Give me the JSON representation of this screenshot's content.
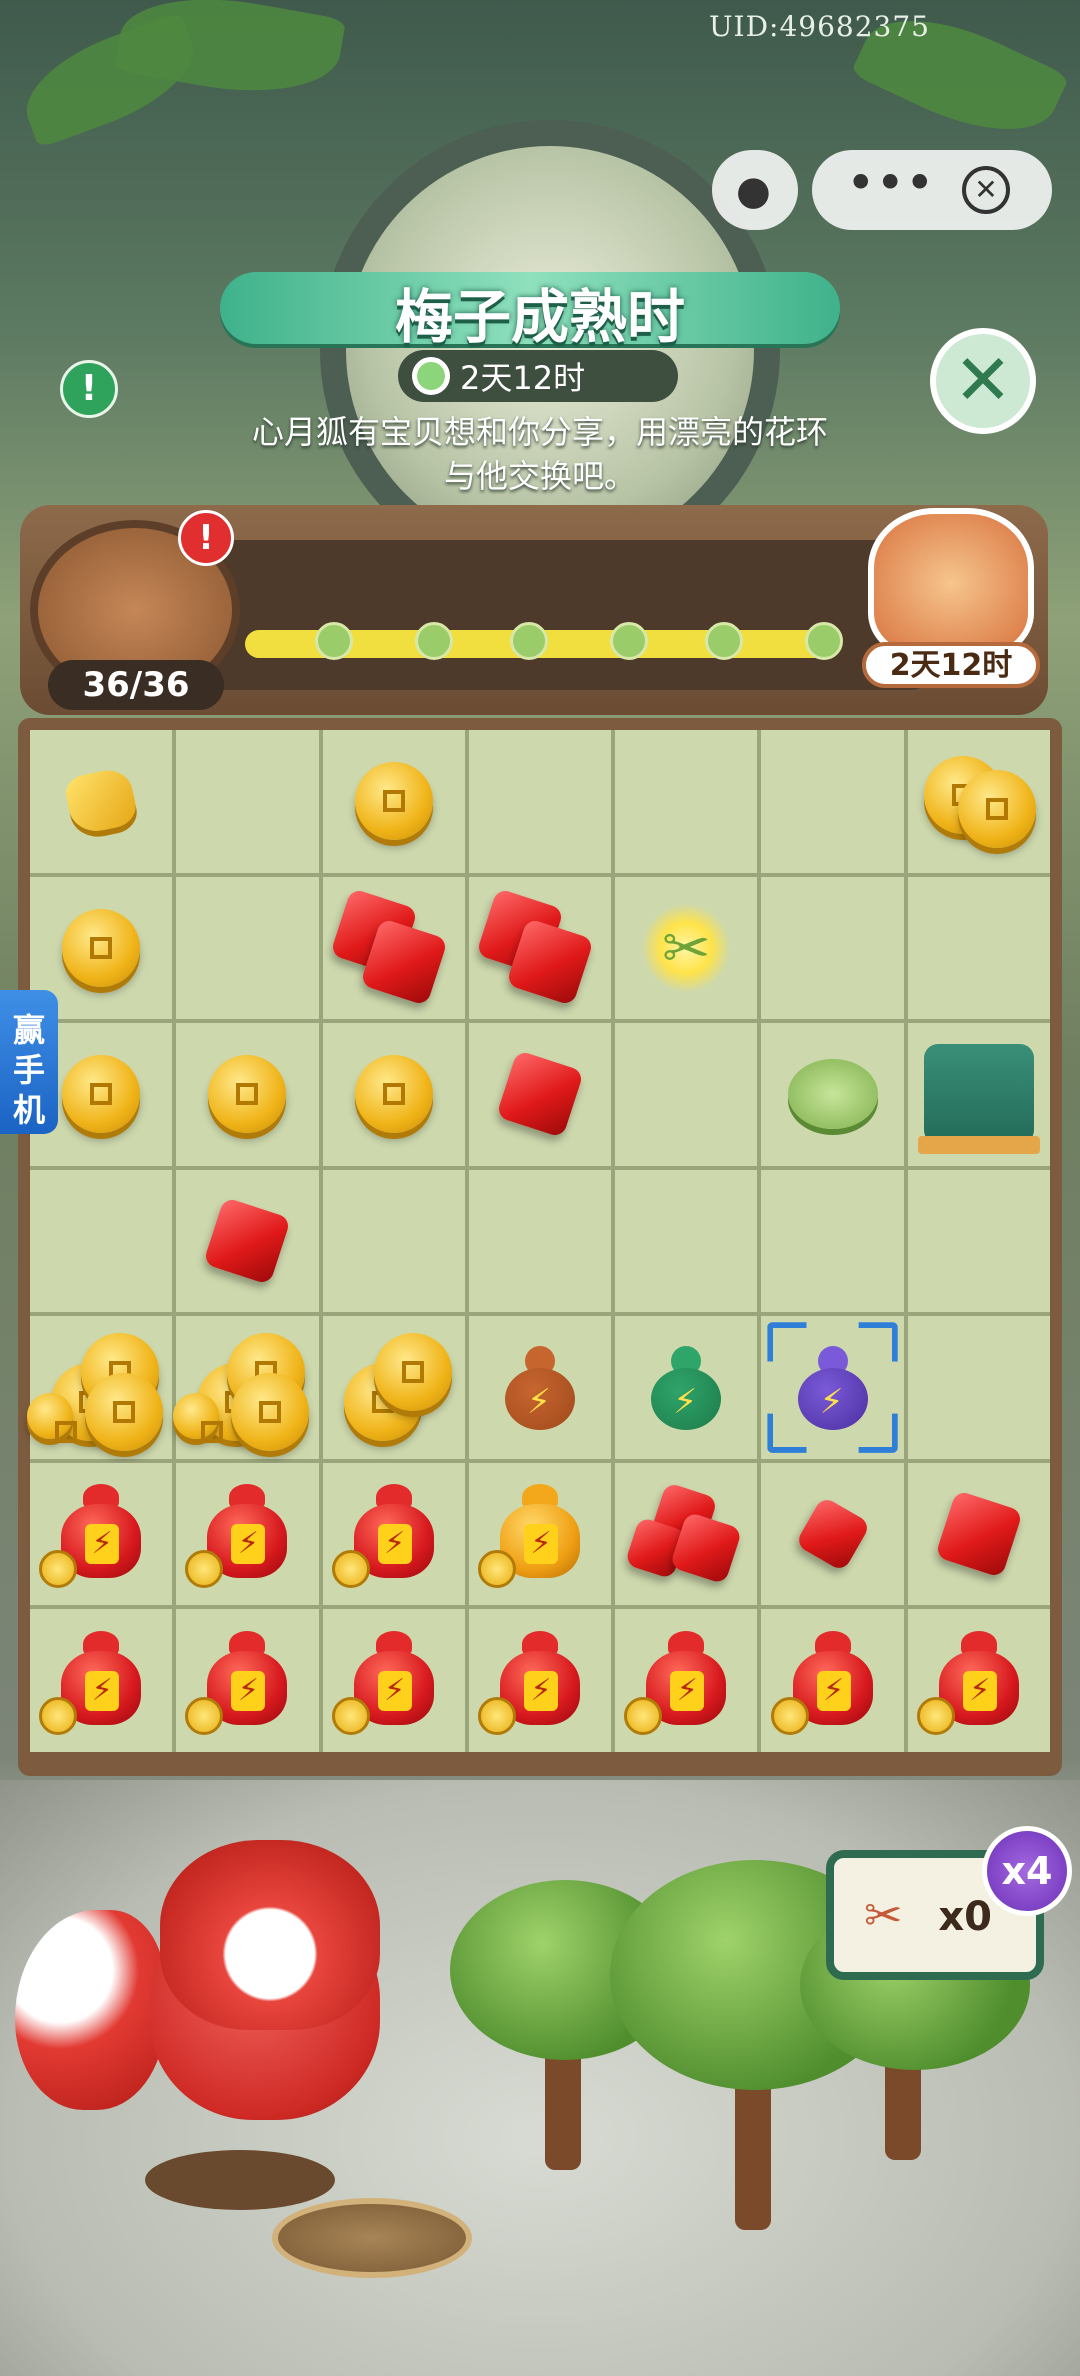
{
  "header": {
    "uid": "UID:49682375"
  },
  "event": {
    "title": "梅子成熟时",
    "timer": "2天12时",
    "description": "心月狐有宝贝想和你分享，用漂亮的花环与他交换吧。",
    "alert_mark": "!",
    "close_symbol": "✕"
  },
  "progress": {
    "counter": "36/36",
    "fill_fraction": 1.0,
    "alert_mark": "!",
    "cat_timer": "2天12时"
  },
  "side_tab": {
    "label": "赢手机"
  },
  "board": {
    "rows": [
      [
        "nugget",
        "empty",
        "coin",
        "empty",
        "empty",
        "empty",
        "coin-pair"
      ],
      [
        "coin",
        "empty",
        "ruby-pair",
        "ruby-pair",
        "scissors",
        "empty",
        "empty"
      ],
      [
        "coin",
        "coin",
        "coin",
        "ruby",
        "empty",
        "tea-bowl",
        "teapot"
      ],
      [
        "empty",
        "ruby",
        "empty",
        "empty",
        "empty",
        "empty",
        "empty"
      ],
      [
        "coin-stack",
        "coin-stack",
        "coin-stack-small",
        "gourd-brown",
        "gourd-green",
        "gourd-purple",
        "empty"
      ],
      [
        "red-jar",
        "red-jar",
        "red-jar",
        "gold-jar",
        "ruby-cluster",
        "ruby-small",
        "ruby"
      ],
      [
        "red-jar",
        "red-jar",
        "red-jar",
        "red-jar",
        "red-jar",
        "red-jar",
        "red-jar"
      ]
    ],
    "selected_cell": "row 5, column 6"
  },
  "garden": {
    "scissors_count": "x0",
    "multiplier": "x4"
  },
  "colors": {
    "accent_green": "#3fb28b",
    "board_wood": "#7d5b3e",
    "cell": "#cdd8ad",
    "selection": "#2f7fd8",
    "ruby": "#e01919",
    "gold": "#f0b419"
  }
}
